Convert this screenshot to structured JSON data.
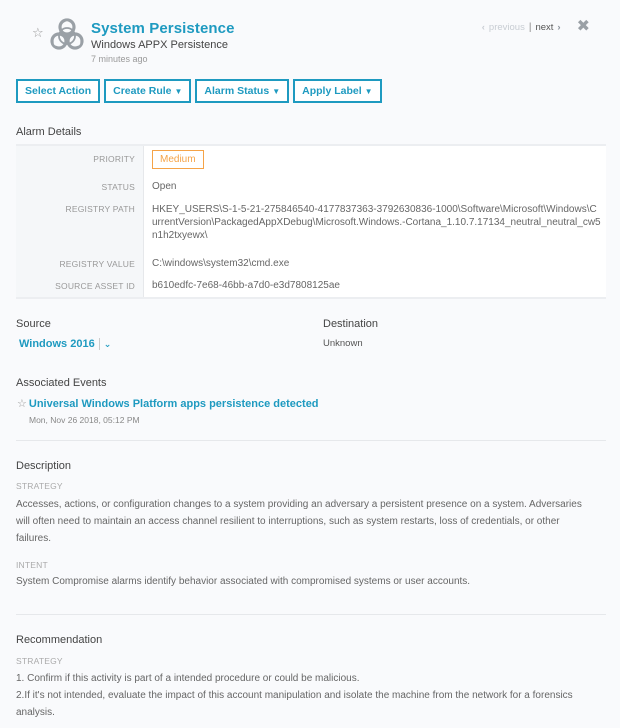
{
  "header": {
    "title": "System Persistence",
    "subtitle": "Windows APPX Persistence",
    "time_ago": "7 minutes ago",
    "icon": "biohazard-icon",
    "pager": {
      "previous_label": "previous",
      "separator": "|",
      "next_label": "next",
      "prev_chevron": "‹",
      "next_chevron": "›",
      "close_glyph": "✖"
    }
  },
  "actions": [
    {
      "label": "Select Action",
      "has_caret": false
    },
    {
      "label": "Create Rule",
      "has_caret": true
    },
    {
      "label": "Alarm Status",
      "has_caret": true
    },
    {
      "label": "Apply Label",
      "has_caret": true
    }
  ],
  "alarm_details": {
    "title": "Alarm Details",
    "rows": {
      "priority": {
        "label": "PRIORITY",
        "value": "Medium"
      },
      "status": {
        "label": "STATUS",
        "value": "Open"
      },
      "registry_path": {
        "label": "REGISTRY PATH",
        "value": "HKEY_USERS\\S-1-5-21-275846540-4177837363-3792630836-1000\\Software\\Microsoft\\Windows\\CurrentVersion\\PackagedAppXDebug\\Microsoft.Windows.-Cortana_1.10.7.17134_neutral_neutral_cw5n1h2txyewx\\"
      },
      "registry_value": {
        "label": "REGISTRY VALUE",
        "value": "C:\\windows\\system32\\cmd.exe"
      },
      "source_asset_id": {
        "label": "SOURCE ASSET ID",
        "value": "b610edfc-7e68-46bb-a7d0-e3d7808125ae"
      }
    }
  },
  "source": {
    "label": "Source",
    "value": "Windows 2016"
  },
  "destination": {
    "label": "Destination",
    "value": "Unknown"
  },
  "associated_events": {
    "title": "Associated Events",
    "items": [
      {
        "name": "Universal Windows Platform apps persistence detected",
        "date": "Mon, Nov 26 2018, 05:12 PM"
      }
    ]
  },
  "description": {
    "title": "Description",
    "strategy_label": "STRATEGY",
    "strategy_text": "Accesses, actions, or configuration changes to a system providing an adversary a persistent presence on a system. Adversaries will often need to maintain an access channel resilient to interruptions, such as system restarts, loss of credentials, or other failures.",
    "intent_label": "INTENT",
    "intent_text": "System Compromise alarms identify behavior associated with compromised systems or user accounts."
  },
  "recommendation": {
    "title": "Recommendation",
    "strategy_label": "STRATEGY",
    "steps": [
      "1. Confirm if this activity is part of a intended procedure or could be malicious.",
      "2.If it's not intended, evaluate the impact of this account manipulation and isolate the machine from the network for a forensics analysis."
    ]
  },
  "colors": {
    "accent": "#1e9ac0",
    "priority_medium": "#f5a347",
    "background": "#f9fafc"
  }
}
